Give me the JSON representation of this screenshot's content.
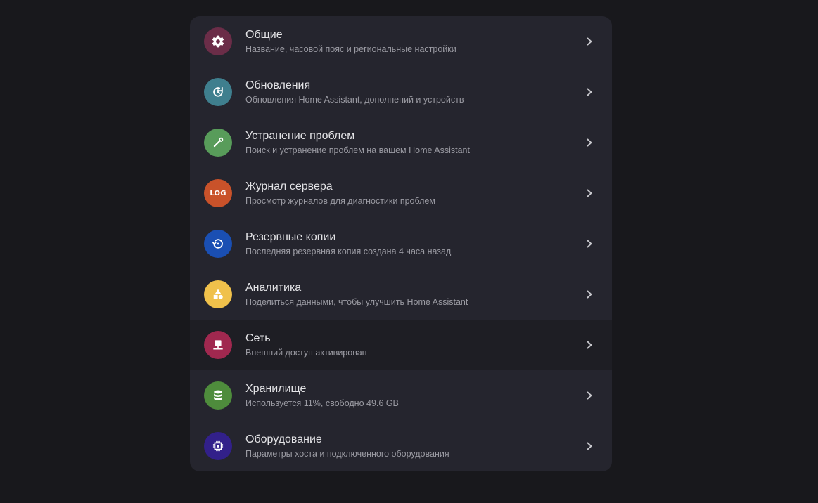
{
  "rows": [
    {
      "title": "Общие",
      "subtitle": "Название, часовой пояс и региональные настройки",
      "icon": "cog-icon",
      "color": "#6b2d48"
    },
    {
      "title": "Обновления",
      "subtitle": "Обновления Home Assistant, дополнений и устройств",
      "icon": "update-icon",
      "color": "#3f7f8e"
    },
    {
      "title": "Устранение проблем",
      "subtitle": "Поиск и устранение проблем на вашем Home Assistant",
      "icon": "wrench-icon",
      "color": "#589c5a"
    },
    {
      "title": "Журнал сервера",
      "subtitle": "Просмотр журналов для диагностики проблем",
      "icon": "log-icon",
      "icon_text": "LOG",
      "color": "#c9522a"
    },
    {
      "title": "Резервные копии",
      "subtitle": "Последняя резервная копия создана 4 часа назад",
      "icon": "backup-icon",
      "color": "#1a4fb3"
    },
    {
      "title": "Аналитика",
      "subtitle": "Поделиться данными, чтобы улучшить Home Assistant",
      "icon": "shapes-icon",
      "color": "#f0c14b"
    },
    {
      "title": "Сеть",
      "subtitle": "Внешний доступ активирован",
      "icon": "network-icon",
      "color": "#a0284f"
    },
    {
      "title": "Хранилище",
      "subtitle": "Используется 11%, свободно 49.6 GB",
      "icon": "database-icon",
      "color": "#4e8c3c"
    },
    {
      "title": "Оборудование",
      "subtitle": "Параметры хоста и подключенного оборудования",
      "icon": "chip-icon",
      "color": "#32208a"
    }
  ],
  "hovered_row_index": 6
}
